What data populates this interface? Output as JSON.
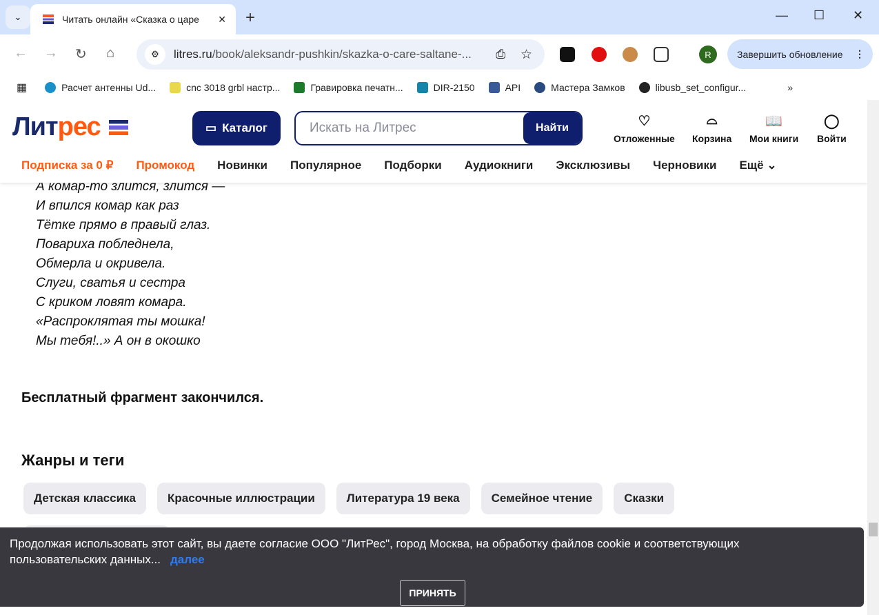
{
  "browser": {
    "tab_title": "Читать онлайн «Сказка о царе",
    "url_host": "litres.ru",
    "url_path": "/book/aleksandr-pushkin/skazka-o-care-saltane-...",
    "update_label": "Завершить обновление",
    "avatar_letter": "R",
    "bookmarks": [
      "Расчет антенны Ud...",
      "cnc 3018 grbl настр...",
      "Гравировка печатн...",
      "DIR-2150",
      "API",
      "Мастера Замков",
      "libusb_set_configur..."
    ]
  },
  "site": {
    "logo_a": "Лит",
    "logo_b": "рес",
    "catalog_label": "Каталог",
    "search_placeholder": "Искать на Литрес",
    "search_button": "Найти",
    "header_icons": [
      {
        "label": "Отложенные",
        "icon": "heart-icon"
      },
      {
        "label": "Корзина",
        "icon": "basket-icon"
      },
      {
        "label": "Мои книги",
        "icon": "book-icon"
      },
      {
        "label": "Войти",
        "icon": "user-icon"
      }
    ],
    "menu": [
      "Подписка за 0 ₽",
      "Промокод",
      "Новинки",
      "Популярное",
      "Подборки",
      "Аудиокниги",
      "Эксклюзивы",
      "Черновики",
      "Ещё"
    ]
  },
  "poem": [
    "А комар-то злится, злится —",
    "И впился комар как раз",
    "Тётке прямо в правый глаз.",
    "Повариха побледнела,",
    "Обмерла и окривела.",
    "Слуги, сватья и сестра",
    "С криком ловят комара.",
    "«Распроклятая ты мошка!",
    "Мы тебя!..» А он в окошко"
  ],
  "fragment_end": "Бесплатный фрагмент закончился.",
  "genres_title": "Жанры и теги",
  "tags": [
    "Детская классика",
    "Красочные иллюстрации",
    "Литература 19 века",
    "Семейное чтение",
    "Сказки"
  ],
  "cookie": {
    "text": "Продолжая использовать этот сайт, вы даете согласие ООО \"ЛитРес\", город Москва, на обработку файлов cookie и соответствующих пользовательских данных...",
    "more": "далее",
    "accept": "ПРИНЯТЬ"
  }
}
